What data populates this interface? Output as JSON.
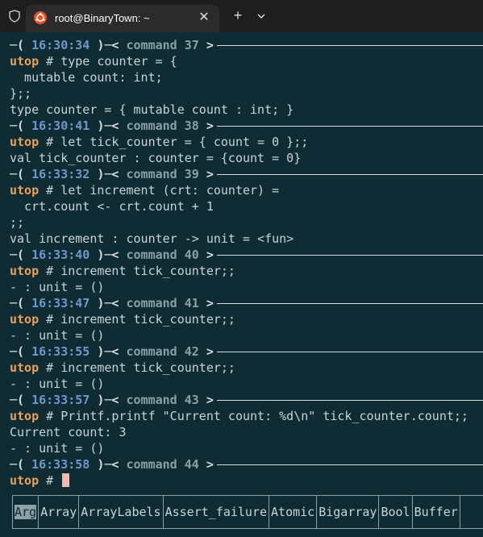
{
  "window": {
    "tab_title": "root@BinaryTown: ~",
    "close_label": "✕",
    "new_tab_label": "+",
    "shield_icon": "shield-icon",
    "tab_icon": "ubuntu-icon",
    "dropdown_icon": "chevron-down-icon"
  },
  "terminal": {
    "prompt": "utop",
    "header_prefix": "─( ",
    "header_mid": " )─< ",
    "header_suffix": " >",
    "command_word": "command",
    "blocks": [
      {
        "time": "16:30:34",
        "num": "37",
        "input": [
          "type counter = {",
          "  mutable count: int;",
          "};;"
        ],
        "output": [
          "type counter = { mutable count : int; }"
        ]
      },
      {
        "time": "16:30:41",
        "num": "38",
        "input": [
          "let tick_counter = { count = 0 };;"
        ],
        "output": [
          "val tick_counter : counter = {count = 0}"
        ]
      },
      {
        "time": "16:33:32",
        "num": "39",
        "input": [
          "let increment (crt: counter) =",
          "  crt.count <- crt.count + 1",
          ";;"
        ],
        "output": [
          "val increment : counter -> unit = <fun>"
        ]
      },
      {
        "time": "16:33:40",
        "num": "40",
        "input": [
          "increment tick_counter;;"
        ],
        "output": [
          "- : unit = ()"
        ]
      },
      {
        "time": "16:33:47",
        "num": "41",
        "input": [
          "increment tick_counter;;"
        ],
        "output": [
          "- : unit = ()"
        ]
      },
      {
        "time": "16:33:55",
        "num": "42",
        "input": [
          "increment tick_counter;;"
        ],
        "output": [
          "- : unit = ()"
        ]
      },
      {
        "time": "16:33:57",
        "num": "43",
        "input": [
          "Printf.printf \"Current count: %d\\n\" tick_counter.count;;"
        ],
        "output": [
          "Current count: 3",
          "- : unit = ()"
        ]
      },
      {
        "time": "16:33:58",
        "num": "44",
        "input": [],
        "output": []
      }
    ],
    "completion_items": [
      "Arg",
      "Array",
      "ArrayLabels",
      "Assert_failure",
      "Atomic",
      "Bigarray",
      "Bool",
      "Buffer"
    ],
    "completion_selected": "Arg",
    "colors": {
      "background": "#0f2b33",
      "prompt": "#e8a25a",
      "time": "#6f98c8",
      "cursor": "#f6b8ad"
    }
  }
}
